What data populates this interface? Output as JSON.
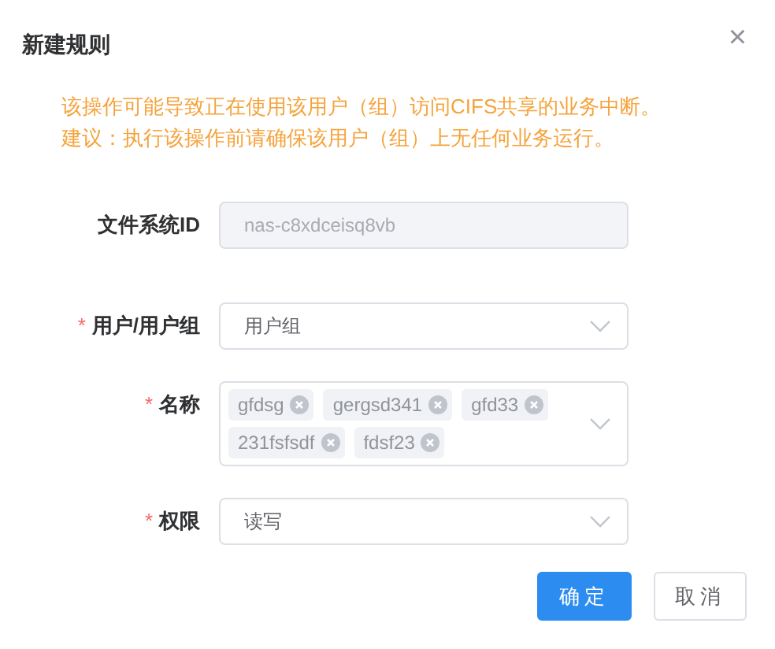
{
  "dialog": {
    "title": "新建规则",
    "close_label": "×"
  },
  "warning": [
    "该操作可能导致正在使用该用户（组）访问CIFS共享的业务中断。",
    "建议：执行该操作前请确保该用户（组）上无任何业务运行。"
  ],
  "fields": [
    {
      "kind": "input",
      "label": "文件系统ID",
      "disabled": true,
      "placeholder": "nas-c8xdceisq8vb"
    },
    {
      "kind": "select",
      "label": "用户/用户组",
      "required_mark": "*",
      "value": "用户组"
    },
    {
      "kind": "tags",
      "label": "名称",
      "required_mark": "*",
      "tags": [
        "gfdsg",
        "gergsd341",
        "gfd33",
        "231fsfsdf",
        "fdsf23"
      ]
    },
    {
      "kind": "select",
      "label": "权限",
      "required_mark": "*",
      "value": "读写"
    }
  ],
  "buttons": [
    {
      "label": "确定",
      "primary": true
    },
    {
      "label": "取消",
      "primary": false
    }
  ]
}
